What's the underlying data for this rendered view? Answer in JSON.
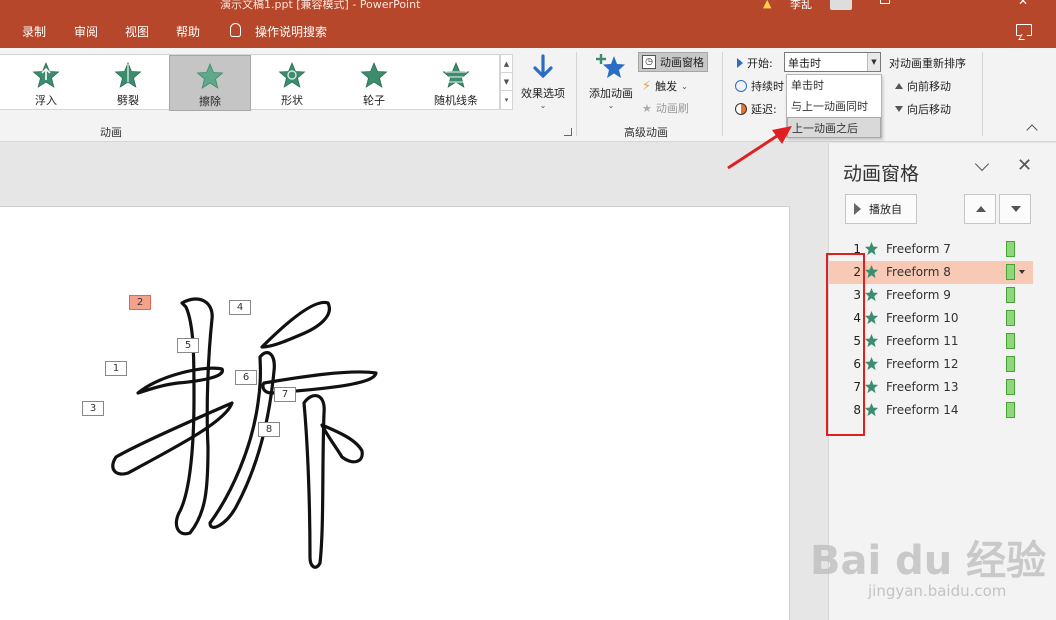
{
  "window": {
    "title": "演示文稿1.ppt [兼容模式] - PowerPoint",
    "user": "李乱"
  },
  "menu": {
    "items": [
      "录制",
      "审阅",
      "视图",
      "帮助",
      "操作说明搜索"
    ]
  },
  "ribbon": {
    "gallery": [
      {
        "label": "浮入",
        "icon": "float-in-star-icon"
      },
      {
        "label": "劈裂",
        "icon": "split-star-icon"
      },
      {
        "label": "擦除",
        "icon": "wipe-star-icon",
        "selected": true
      },
      {
        "label": "形状",
        "icon": "shape-star-icon"
      },
      {
        "label": "轮子",
        "icon": "wheel-star-icon"
      },
      {
        "label": "随机线条",
        "icon": "random-bars-star-icon"
      }
    ],
    "effect_options": "效果选项",
    "group_animation": "动画",
    "add_animation": "添加动画",
    "animation_pane": "动画窗格",
    "trigger": "触发",
    "animation_painter": "动画刷",
    "group_advanced": "高级动画",
    "start_label": "开始:",
    "start_value": "单击时",
    "duration_label": "持续时",
    "delay_label": "延迟:",
    "start_options": [
      "单击时",
      "与上一动画同时",
      "上一动画之后"
    ],
    "start_options_highlighted": "上一动画之后",
    "reorder_title": "对动画重新排序",
    "move_earlier": "向前移动",
    "move_later": "向后移动"
  },
  "pane": {
    "title": "动画窗格",
    "play_from": "播放自",
    "items": [
      {
        "num": "1",
        "name": "Freeform 7"
      },
      {
        "num": "2",
        "name": "Freeform 8",
        "selected": true
      },
      {
        "num": "3",
        "name": "Freeform 9"
      },
      {
        "num": "4",
        "name": "Freeform 10"
      },
      {
        "num": "5",
        "name": "Freeform 11"
      },
      {
        "num": "6",
        "name": "Freeform 12"
      },
      {
        "num": "7",
        "name": "Freeform 13"
      },
      {
        "num": "8",
        "name": "Freeform 14"
      }
    ]
  },
  "slide": {
    "tags": [
      "1",
      "2",
      "3",
      "4",
      "5",
      "6",
      "7",
      "8"
    ],
    "active_tag": "2"
  },
  "watermark": {
    "brand": "Bai du 经验",
    "url": "jingyan.baidu.com"
  },
  "colors": {
    "accent": "#b7472a",
    "selection": "#f8c9b4",
    "timing_bar": "#8ed87a",
    "highlight_box": "#e02020"
  }
}
